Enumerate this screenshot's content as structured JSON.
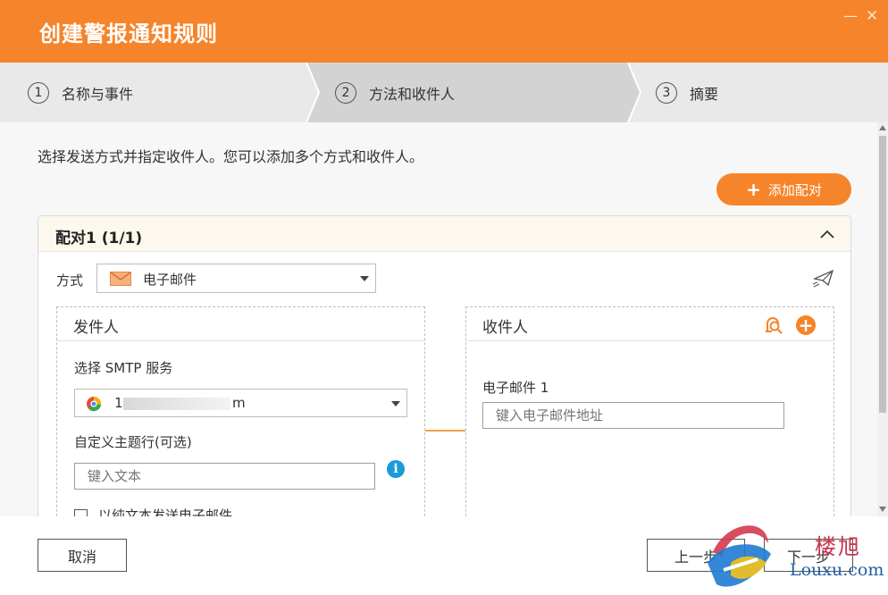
{
  "dialog": {
    "title": "创建警报通知规则",
    "minimize_glyph": "—",
    "close_glyph": "✕"
  },
  "steps": [
    {
      "num": "1",
      "label": "名称与事件",
      "active": false
    },
    {
      "num": "2",
      "label": "方法和收件人",
      "active": true
    },
    {
      "num": "3",
      "label": "摘要",
      "active": false
    }
  ],
  "content": {
    "intro": "选择发送方式并指定收件人。您可以添加多个方式和收件人。",
    "add_pair_label": "添加配对",
    "add_pair_glyph": "+"
  },
  "pair": {
    "title": "配对1 (1/1)",
    "method_label": "方式",
    "method_value": "电子邮件",
    "method_icon": "mail-icon",
    "sender": {
      "title": "发件人",
      "smtp_label": "选择 SMTP 服务",
      "smtp_value": "1",
      "smtp_value_tail": "m",
      "subject_label": "自定义主题行(可选)",
      "subject_placeholder": "键入文本",
      "info_glyph": "i",
      "plain_text_label": "以纯文本发送电子邮件"
    },
    "recipient": {
      "title": "收件人",
      "add_glyph": "+",
      "email_label": "电子邮件 1",
      "email_placeholder": "键入电子邮件地址"
    }
  },
  "footer": {
    "cancel_label": "取消",
    "prev_label": "上一步",
    "next_label": "下一步"
  },
  "watermark": {
    "cn": "楼旭",
    "en": "Louxu.com"
  },
  "colors": {
    "accent": "#f6842a",
    "info": "#1a9bd7",
    "step_bar": "#e9e9e9",
    "step_active": "#d3d3d3"
  }
}
